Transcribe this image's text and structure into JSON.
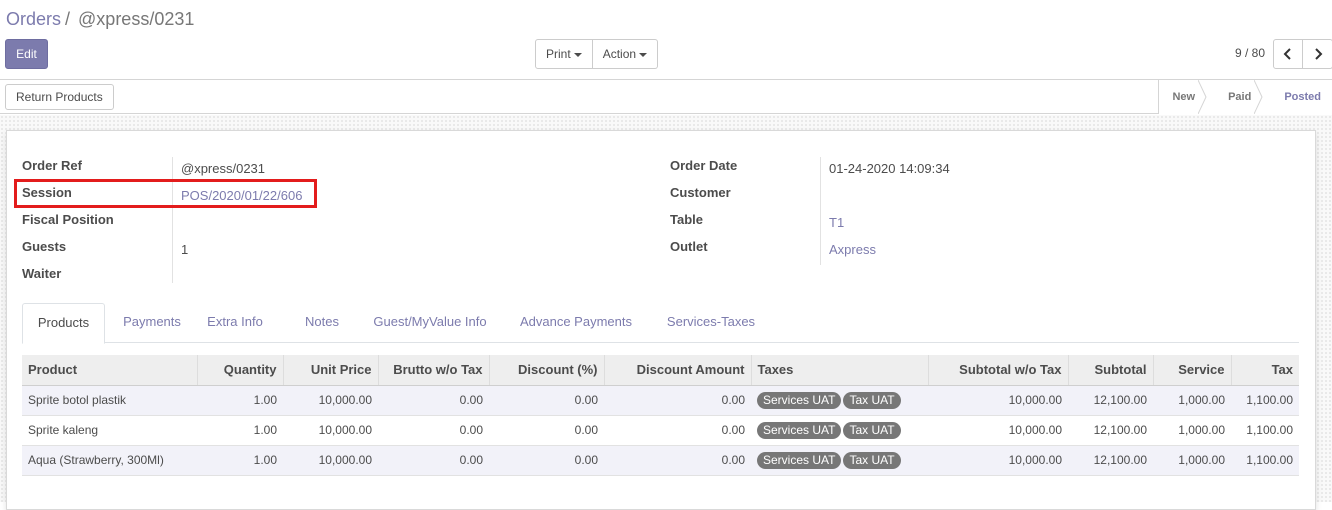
{
  "breadcrumb": {
    "parent": "Orders",
    "separator": "/",
    "current": "@xpress/0231"
  },
  "buttons": {
    "edit": "Edit",
    "print": "Print",
    "action": "Action",
    "return_products": "Return Products"
  },
  "pager": {
    "value": "9 / 80"
  },
  "statusbar": {
    "stages": [
      "New",
      "Paid",
      "Posted"
    ],
    "active_stage": "Posted"
  },
  "form": {
    "order_ref": {
      "label": "Order Ref",
      "value": "@xpress/0231"
    },
    "session": {
      "label": "Session",
      "value": "POS/2020/01/22/606"
    },
    "fiscal_position": {
      "label": "Fiscal Position",
      "value": ""
    },
    "guests": {
      "label": "Guests",
      "value": "1"
    },
    "waiter": {
      "label": "Waiter",
      "value": ""
    },
    "order_date": {
      "label": "Order Date",
      "value": "01-24-2020 14:09:34"
    },
    "customer": {
      "label": "Customer",
      "value": ""
    },
    "table": {
      "label": "Table",
      "value": "T1"
    },
    "outlet": {
      "label": "Outlet",
      "value": "Axpress"
    }
  },
  "tabs": [
    "Products",
    "Payments",
    "Extra Info",
    "Notes",
    "Guest/MyValue Info",
    "Advance Payments",
    "Services-Taxes"
  ],
  "active_tab": "Products",
  "lines": {
    "columns": [
      "Product",
      "Quantity",
      "Unit Price",
      "Brutto w/o Tax",
      "Discount (%)",
      "Discount Amount",
      "Taxes",
      "Subtotal w/o Tax",
      "Subtotal",
      "Service",
      "Tax"
    ],
    "rows": [
      {
        "product": "Sprite botol plastik",
        "quantity": "1.00",
        "unit_price": "10,000.00",
        "brutto": "0.00",
        "discount_pct": "0.00",
        "discount_amount": "0.00",
        "taxes": [
          "Services UAT",
          "Tax UAT"
        ],
        "subtotal_wo_tax": "10,000.00",
        "subtotal": "12,100.00",
        "service": "1,000.00",
        "tax": "1,100.00"
      },
      {
        "product": "Sprite kaleng",
        "quantity": "1.00",
        "unit_price": "10,000.00",
        "brutto": "0.00",
        "discount_pct": "0.00",
        "discount_amount": "0.00",
        "taxes": [
          "Services UAT",
          "Tax UAT"
        ],
        "subtotal_wo_tax": "10,000.00",
        "subtotal": "12,100.00",
        "service": "1,000.00",
        "tax": "1,100.00"
      },
      {
        "product": "Aqua (Strawberry, 300Ml)",
        "quantity": "1.00",
        "unit_price": "10,000.00",
        "brutto": "0.00",
        "discount_pct": "0.00",
        "discount_amount": "0.00",
        "taxes": [
          "Services UAT",
          "Tax UAT"
        ],
        "subtotal_wo_tax": "10,000.00",
        "subtotal": "12,100.00",
        "service": "1,000.00",
        "tax": "1,100.00"
      }
    ]
  },
  "colors": {
    "primary": "#7c7bad",
    "highlight_box": "#e31c1c",
    "tag": "#777777"
  }
}
